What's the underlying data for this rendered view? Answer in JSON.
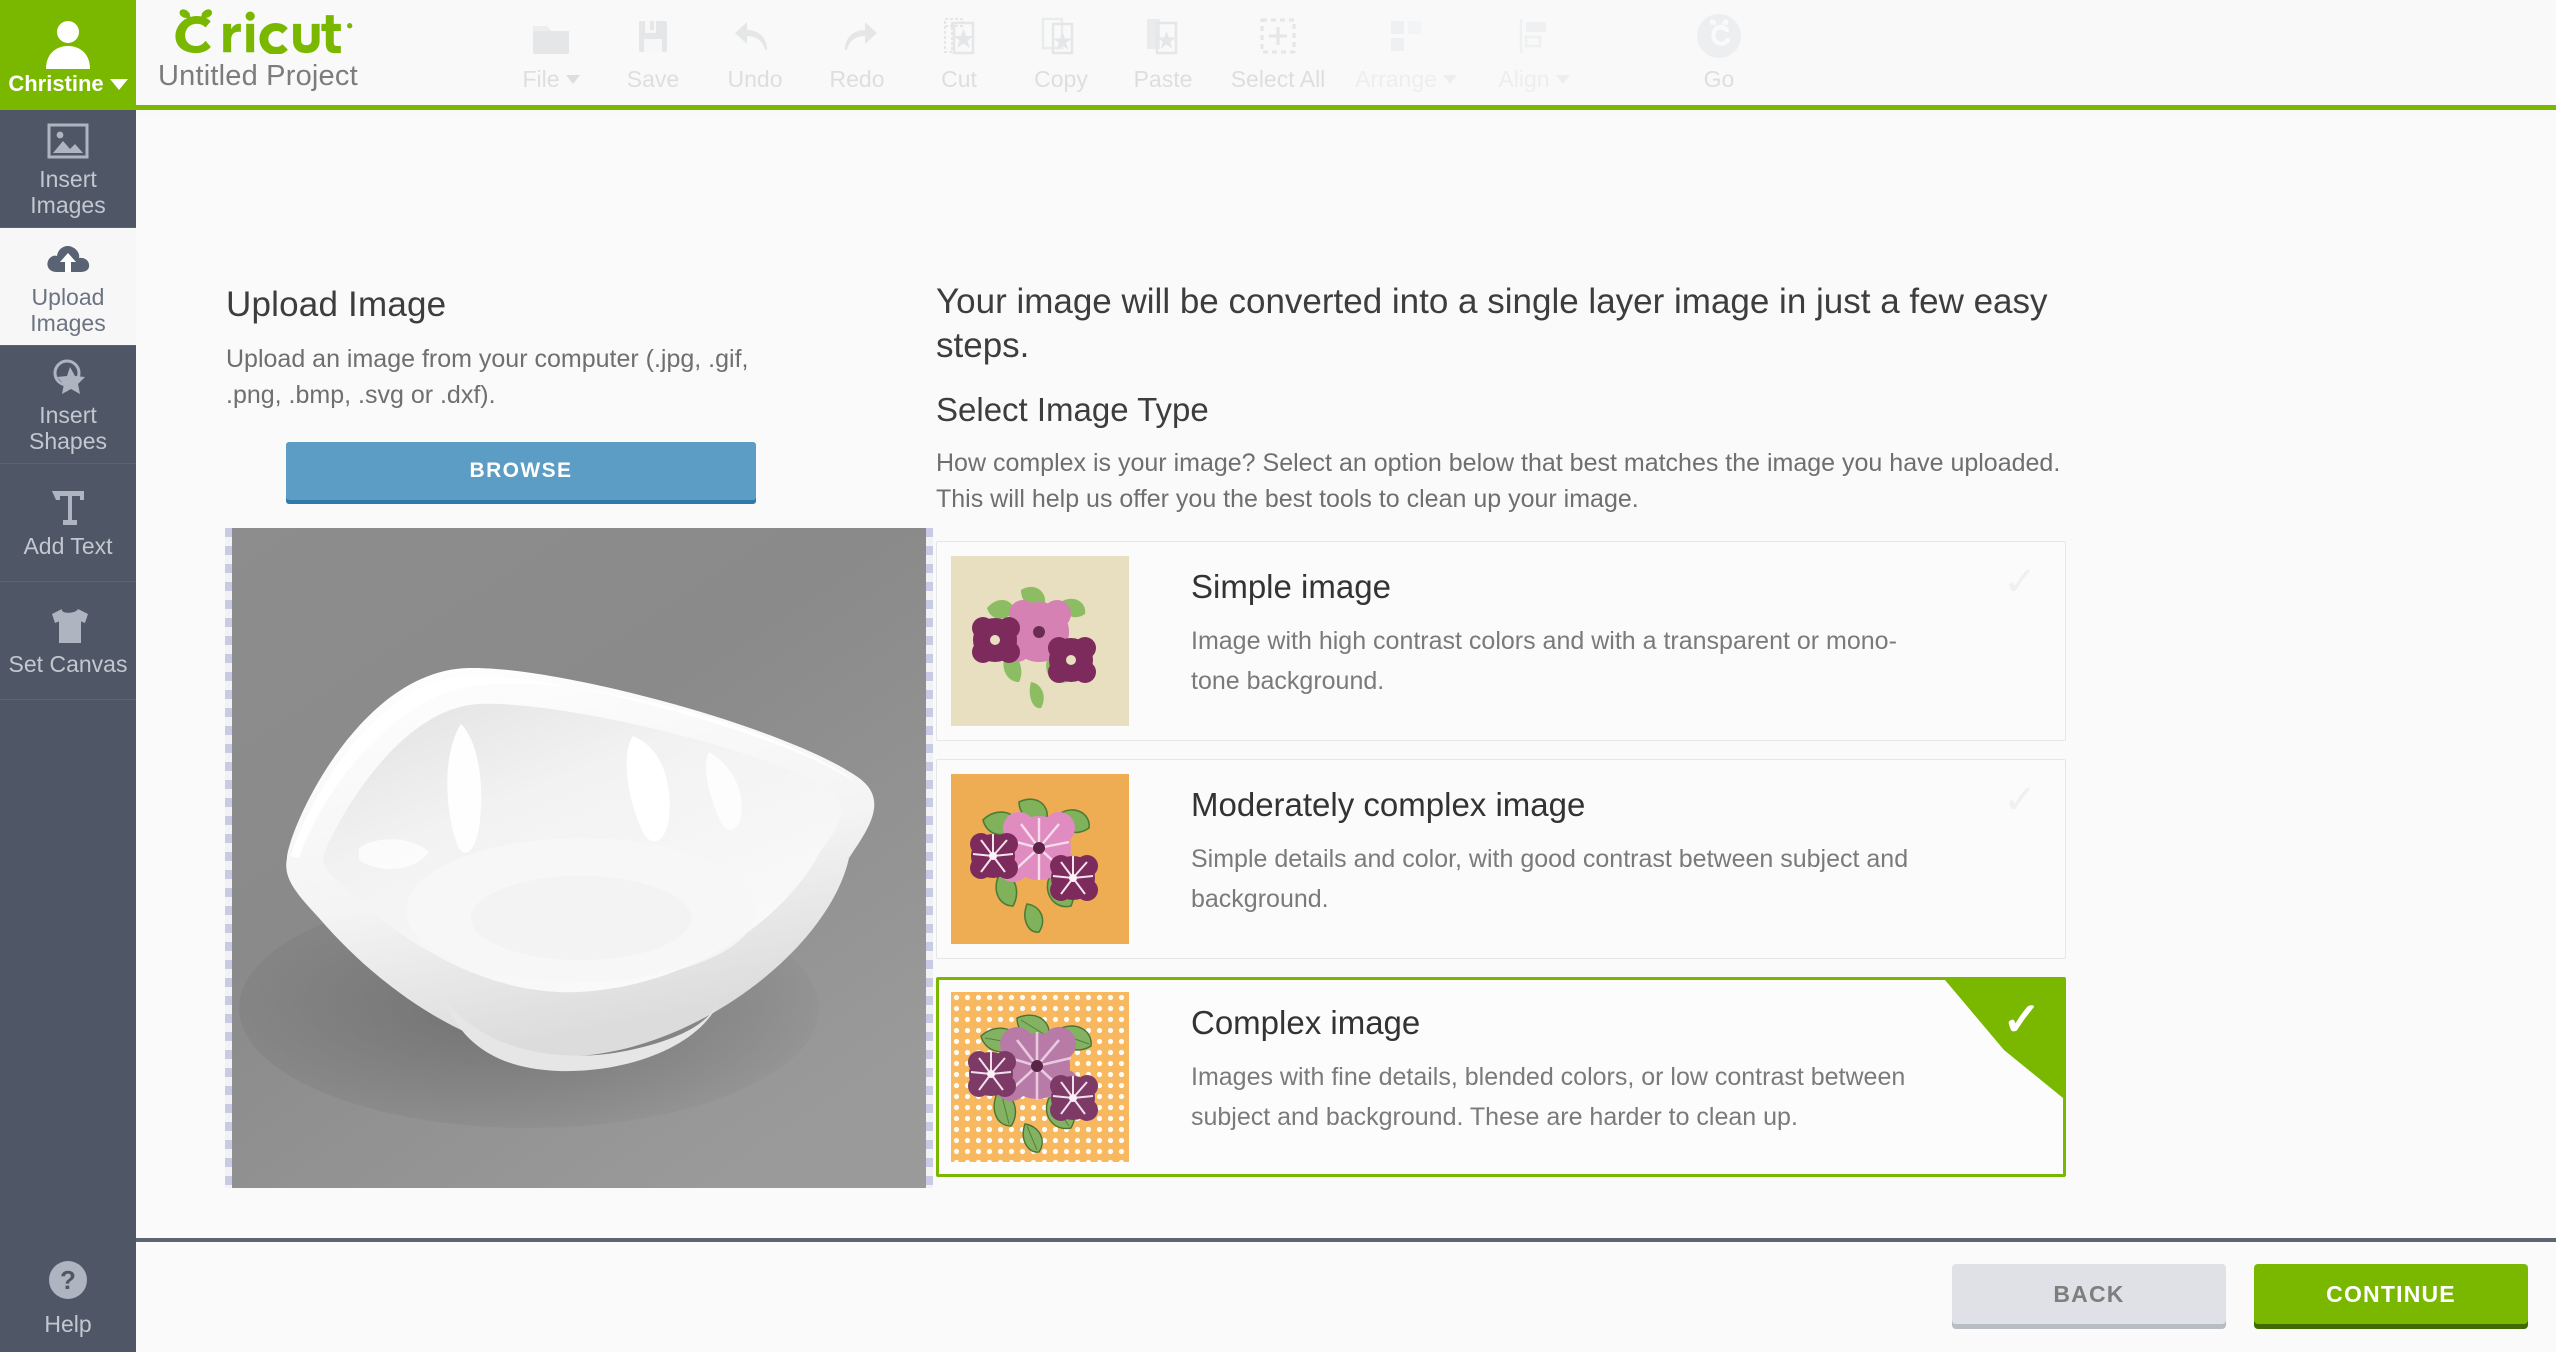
{
  "brand": {
    "logo_text": "Cricut",
    "project_title": "Untitled Project",
    "accent_green": "#7ab800"
  },
  "user": {
    "name": "Christine",
    "avatar_icon": "user-avatar-icon",
    "caret_icon": "chevron-down-icon"
  },
  "toolbar": {
    "items": [
      {
        "label": "File",
        "icon": "folder-icon",
        "has_caret": true,
        "disabled": false
      },
      {
        "label": "Save",
        "icon": "floppy-disk-icon",
        "has_caret": false,
        "disabled": false
      },
      {
        "label": "Undo",
        "icon": "undo-arrow-icon",
        "has_caret": false,
        "disabled": false
      },
      {
        "label": "Redo",
        "icon": "redo-arrow-icon",
        "has_caret": false,
        "disabled": false
      },
      {
        "label": "Cut",
        "icon": "cut-icon",
        "has_caret": false,
        "disabled": false
      },
      {
        "label": "Copy",
        "icon": "copy-icon",
        "has_caret": false,
        "disabled": false
      },
      {
        "label": "Paste",
        "icon": "paste-icon",
        "has_caret": false,
        "disabled": false
      },
      {
        "label": "Select All",
        "icon": "select-all-icon",
        "has_caret": false,
        "disabled": false
      },
      {
        "label": "Arrange",
        "icon": "arrange-icon",
        "has_caret": true,
        "disabled": true
      },
      {
        "label": "Align",
        "icon": "align-icon",
        "has_caret": true,
        "disabled": true
      },
      {
        "label": "Go",
        "icon": "cricut-go-icon",
        "has_caret": false,
        "disabled": false
      }
    ]
  },
  "sidebar": {
    "items": [
      {
        "label": "Insert\nImages",
        "icon": "picture-icon",
        "active": false
      },
      {
        "label": "Upload\nImages",
        "icon": "cloud-upload-icon",
        "active": true
      },
      {
        "label": "Insert\nShapes",
        "icon": "shapes-star-icon",
        "active": false
      },
      {
        "label": "Add Text",
        "icon": "text-t-icon",
        "active": false
      },
      {
        "label": "Set Canvas",
        "icon": "tshirt-icon",
        "active": false
      }
    ],
    "help": {
      "label": "Help",
      "icon": "question-mark-icon"
    }
  },
  "upload": {
    "title": "Upload Image",
    "subtitle": "Upload an image from your computer (.jpg, .gif, .png, .bmp, .svg or .dxf).",
    "browse_label": "BROWSE",
    "preview_alt": "white-square-ceramic-bowl-photo"
  },
  "right": {
    "intro": "Your image will be converted into a single layer image in just a few easy steps.",
    "heading": "Select Image Type",
    "description": "How complex is your image? Select an option below that best matches the image you have uploaded. This will help us offer you the best tools to clean up your image.",
    "options": [
      {
        "name": "Simple image",
        "desc": "Image with high contrast colors and with a transparent or mono-tone background.",
        "thumb_bg": "#e8dec0",
        "thumb_style": "flat",
        "selected": false,
        "check_icon": "checkmark-icon"
      },
      {
        "name": "Moderately complex image",
        "desc": "Simple details and color, with good contrast between subject and background.",
        "thumb_bg": "#eead53",
        "thumb_style": "detailed",
        "selected": false,
        "check_icon": "checkmark-icon"
      },
      {
        "name": "Complex image",
        "desc": "Images with fine details, blended colors, or low contrast between subject and background. These are harder to clean up.",
        "thumb_bg": "#f7b860",
        "thumb_style": "dotted",
        "selected": true,
        "check_icon": "checkmark-icon"
      }
    ]
  },
  "footer": {
    "back_label": "BACK",
    "continue_label": "CONTINUE"
  }
}
